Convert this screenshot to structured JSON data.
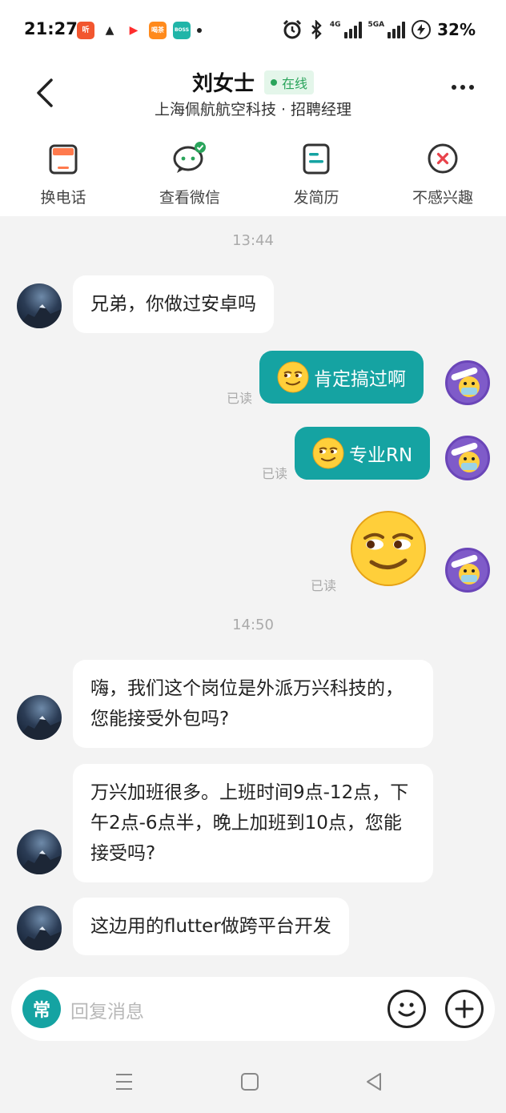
{
  "status_bar": {
    "time": "21:27",
    "apps": [
      {
        "label": "听",
        "color": "#f2562f"
      },
      {
        "label": "▲",
        "color": "#222222"
      },
      {
        "label": "▶",
        "color": "#ff2d2d"
      },
      {
        "label": "喝茶",
        "color": "#ff8a1c"
      },
      {
        "label": "BOSS",
        "color": "#20b5a8"
      }
    ],
    "signal1_label": "4G",
    "signal2_label": "5GA",
    "battery": "32%"
  },
  "header": {
    "title": "刘女士",
    "status": "在线",
    "subtitle": "上海佩航航空科技 · 招聘经理"
  },
  "actions": [
    {
      "label": "换电话"
    },
    {
      "label": "查看微信"
    },
    {
      "label": "发简历"
    },
    {
      "label": "不感兴趣"
    }
  ],
  "chat": {
    "timestamp1": "13:44",
    "timestamp2": "14:50",
    "read_label": "已读",
    "messages": [
      {
        "text": "兄弟，你做过安卓吗"
      },
      {
        "text": "肯定搞过啊"
      },
      {
        "text": "专业RN"
      },
      {
        "text": "嗨，我们这个岗位是外派万兴科技的，您能接受外包吗?"
      },
      {
        "text": "万兴加班很多。上班时间9点-12点，下午2点-6点半，晚上加班到10点，您能接受吗?"
      },
      {
        "text": "这边用的flutter做跨平台开发"
      }
    ]
  },
  "input": {
    "quick_label": "常",
    "placeholder": "回复消息"
  },
  "colors": {
    "accent": "#15a3a2",
    "online_green": "#2aa45b",
    "background": "#f3f3f3"
  }
}
